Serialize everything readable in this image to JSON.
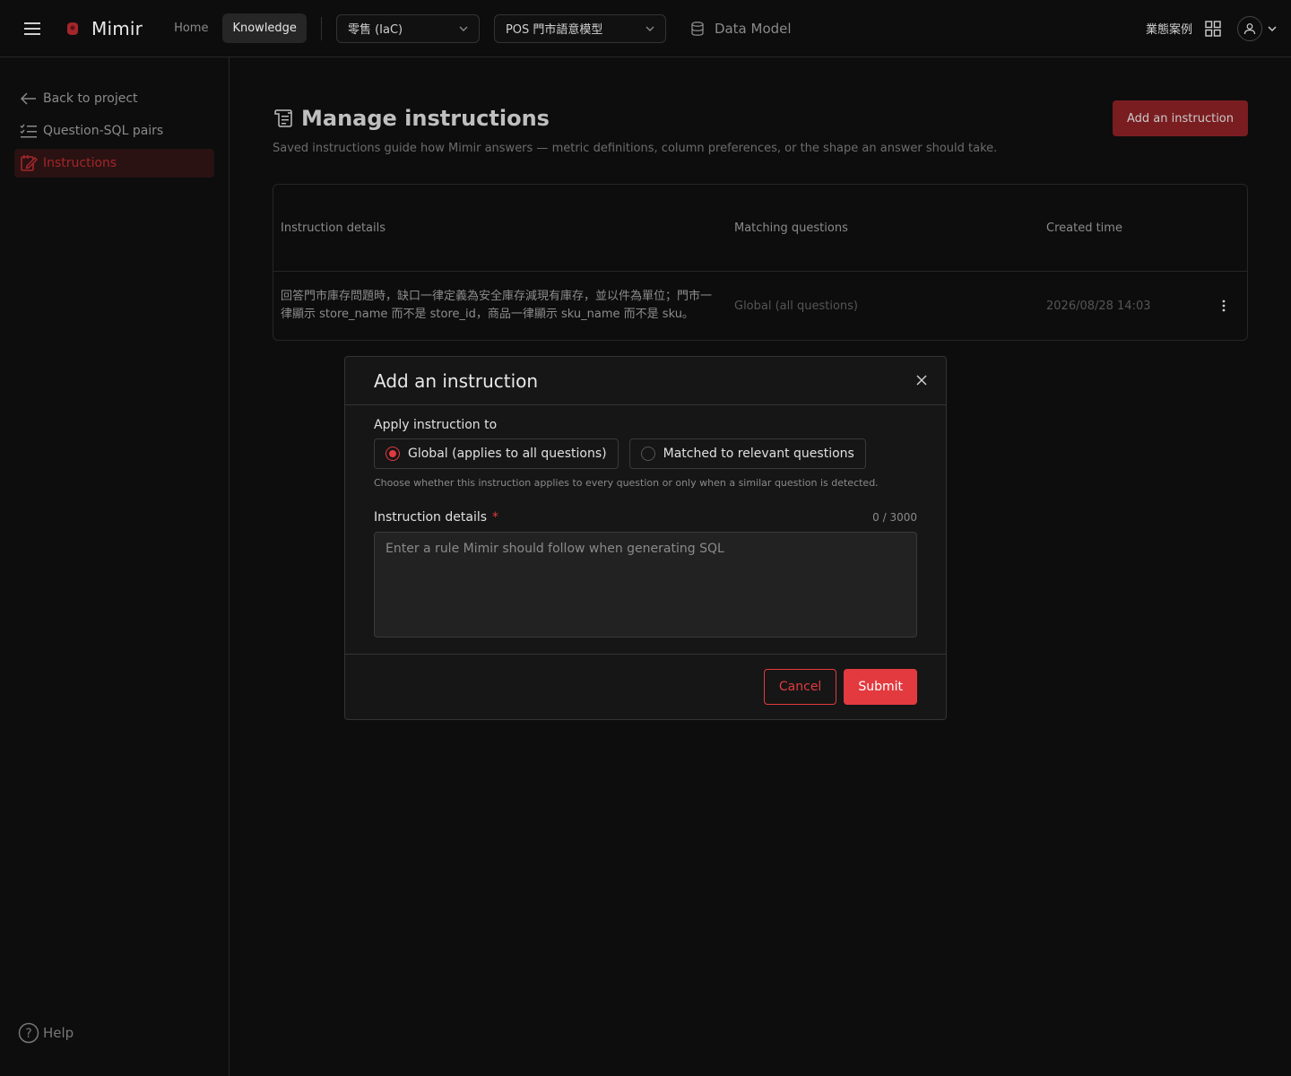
{
  "topbar": {
    "app_name": "Mimir",
    "nav": {
      "home": "Home",
      "knowledge": "Knowledge"
    },
    "industry_select": "零售 (IaC)",
    "model_select": "POS 門市語意模型",
    "data_model": "Data Model",
    "biz_cases": "業態案例",
    "icons": {
      "menu": "hamburger-icon",
      "grid": "grid-icon",
      "user": "user-icon"
    }
  },
  "sidebar": {
    "items": [
      {
        "label": "Back to project",
        "icon": "arrow-left-icon"
      },
      {
        "label": "Question-SQL pairs",
        "icon": "list-check-icon"
      },
      {
        "label": "Instructions",
        "icon": "edit-note-icon",
        "active": true
      }
    ],
    "help": "Help"
  },
  "main": {
    "title": "Manage instructions",
    "subtitle": "Saved instructions guide how Mimir answers — metric definitions, column preferences, or the shape an answer should take.",
    "add_button": "Add an instruction",
    "table": {
      "headers": [
        "Instruction details",
        "Matching questions",
        "Created time"
      ],
      "rows": [
        {
          "details": "回答門市庫存問題時，缺口一律定義為安全庫存減現有庫存，並以件為單位；門市一律顯示 store_name 而不是 store_id，商品一律顯示 sku_name 而不是 sku。",
          "matching": "Global (all questions)",
          "created": "2026/08/28 14:03"
        }
      ]
    }
  },
  "modal": {
    "title": "Add an instruction",
    "apply_label": "Apply instruction to",
    "options": [
      "Global (applies to all questions)",
      "Matched to relevant questions"
    ],
    "selected_option": 0,
    "hint": "Choose whether this instruction applies to every question or only when a similar question is detected.",
    "details_label": "Instruction details",
    "required_mark": "*",
    "counter": "0 / 3000",
    "placeholder": "Enter a rule Mimir should follow when generating SQL",
    "value": "",
    "cancel": "Cancel",
    "submit": "Submit"
  },
  "colors": {
    "accent": "#e23a3f",
    "accent_dark": "#7a1d20",
    "background": "#0d0d0d",
    "panel": "#161616"
  }
}
